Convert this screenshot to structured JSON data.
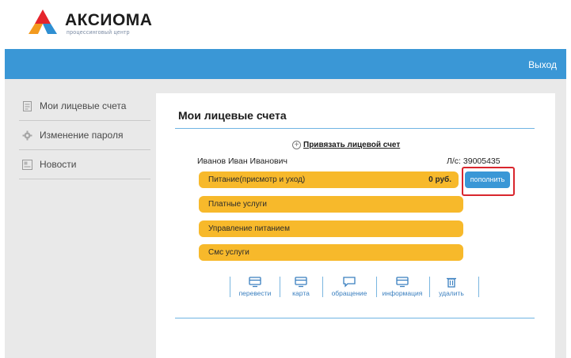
{
  "brand": {
    "name": "АКСИОМА",
    "subtitle": "процессинговый центр",
    "colors": {
      "red": "#e5252c",
      "orange": "#f39a1e",
      "blue": "#2f8fd2"
    }
  },
  "topbar": {
    "logout_label": "Выход",
    "color": "#3a97d6"
  },
  "sidebar": {
    "items": [
      {
        "label": "Мои лицевые счета",
        "icon": "accounts-icon"
      },
      {
        "label": "Изменение пароля",
        "icon": "gear-icon"
      },
      {
        "label": "Новости",
        "icon": "news-icon"
      }
    ]
  },
  "main": {
    "title": "Мои лицевые счета",
    "bind_account_label": "Привязать лицевой счет",
    "account": {
      "owner": "Иванов Иван Иванович",
      "number_label": "Л/с: 39005435"
    },
    "services": [
      {
        "name": "Питание(присмотр и уход)",
        "amount": "0 руб."
      },
      {
        "name": "Платные услуги"
      },
      {
        "name": "Управление питанием"
      },
      {
        "name": "Смс услуги"
      }
    ],
    "topup_label": "пополнить",
    "actions": [
      {
        "label": "перевести",
        "icon": "transfer-icon"
      },
      {
        "label": "карта",
        "icon": "card-icon"
      },
      {
        "label": "обращение",
        "icon": "message-icon"
      },
      {
        "label": "информация",
        "icon": "info-icon"
      },
      {
        "label": "удалить",
        "icon": "trash-icon"
      }
    ],
    "accent_color": "#f7b92b",
    "highlight_color": "#d9262d"
  }
}
